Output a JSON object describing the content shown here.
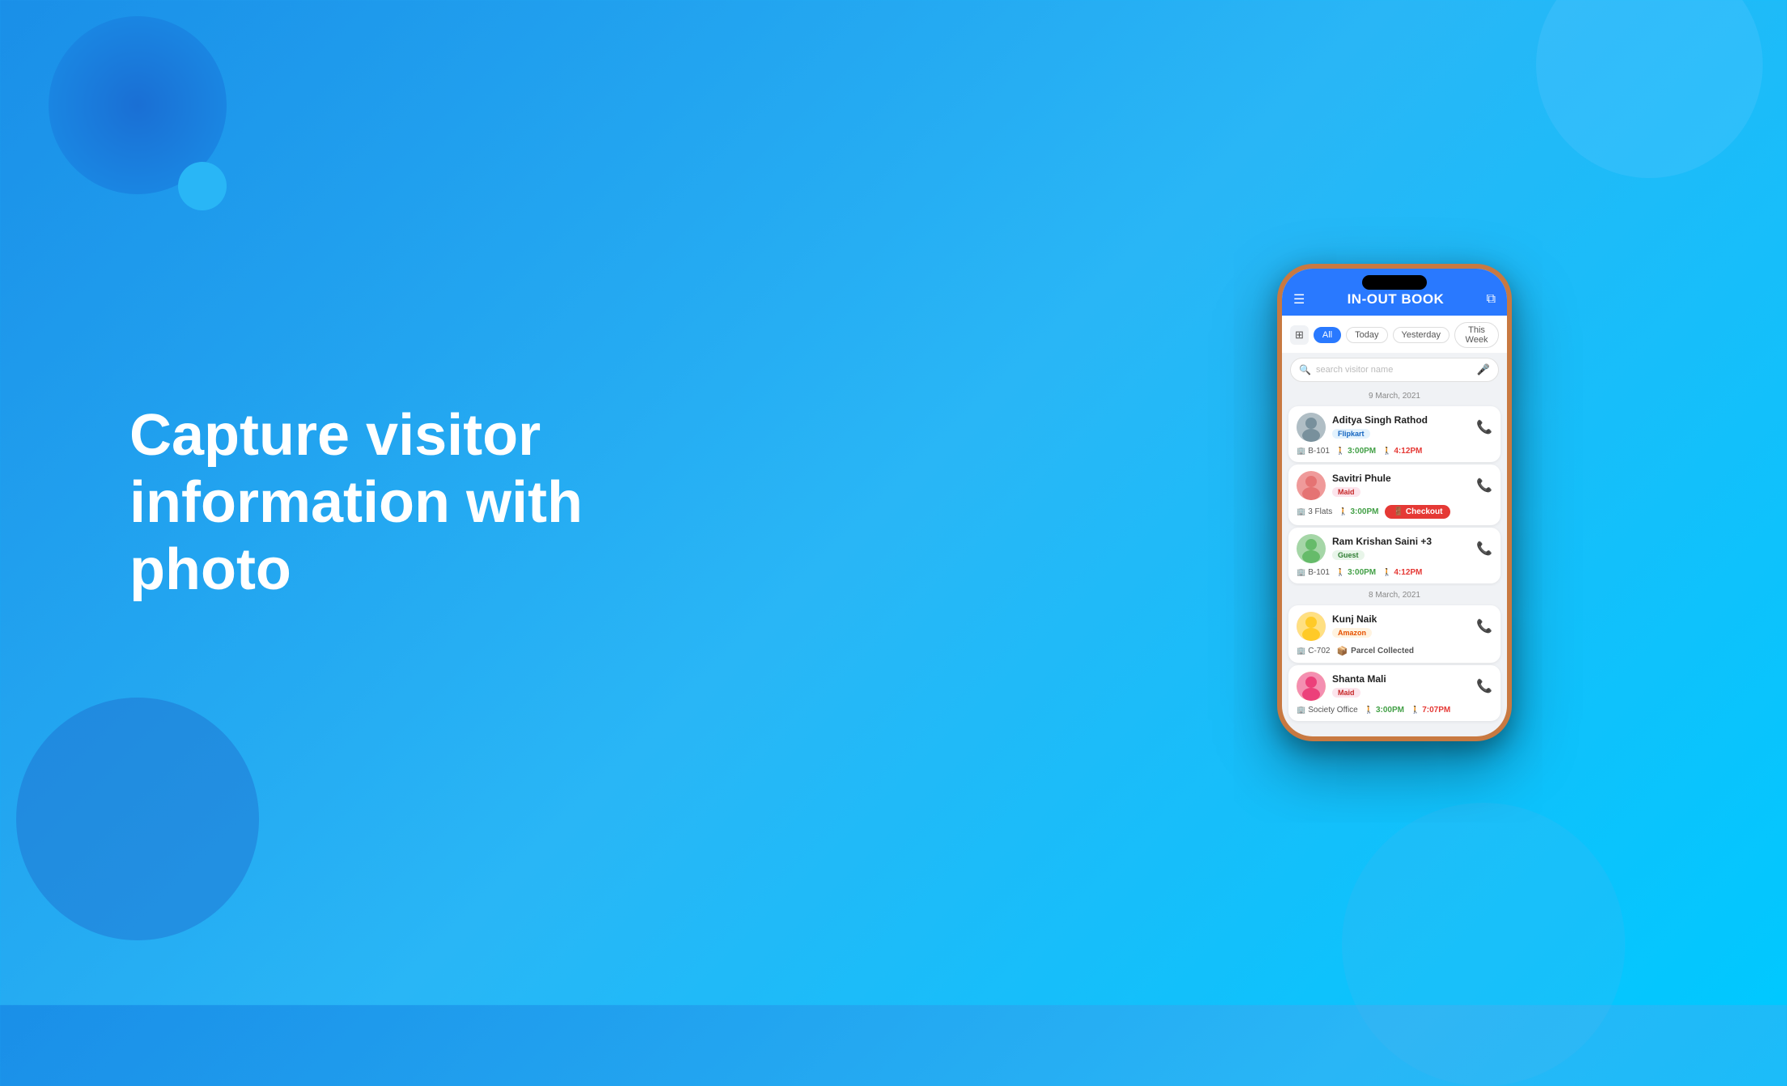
{
  "background": {
    "gradient_start": "#1a8fe8",
    "gradient_end": "#29c5f6"
  },
  "left_content": {
    "heading_line1": "Capture visitor",
    "heading_line2": "information with photo"
  },
  "app": {
    "title": "IN-OUT BOOK",
    "header": {
      "menu_icon": "☰",
      "expand_icon": "⛶"
    },
    "filters": {
      "grid_btn": "⊞",
      "tabs": [
        "All",
        "Today",
        "Yesterday",
        "This Week"
      ],
      "active_tab": "All"
    },
    "search": {
      "placeholder": "search visitor name",
      "mic_icon": "🎤"
    },
    "date_groups": [
      {
        "date": "9 March, 2021",
        "visitors": [
          {
            "id": 1,
            "name": "Aditya Singh Rathod",
            "badge": "Flipkart",
            "badge_type": "flipkart",
            "flat": "B-101",
            "time_in": "3:00PM",
            "time_out": "4:12PM",
            "has_checkout_btn": false,
            "has_parcel": false,
            "avatar_color": "#b0bec5"
          },
          {
            "id": 2,
            "name": "Savitri Phule",
            "badge": "Maid",
            "badge_type": "maid",
            "flat": "3 Flats",
            "time_in": "3:00PM",
            "time_out": null,
            "has_checkout_btn": true,
            "has_parcel": false,
            "avatar_color": "#ef9a9a"
          },
          {
            "id": 3,
            "name": "Ram Krishan Saini +3",
            "badge": "Guest",
            "badge_type": "guest",
            "flat": "B-101",
            "time_in": "3:00PM",
            "time_out": "4:12PM",
            "has_checkout_btn": false,
            "has_parcel": false,
            "avatar_color": "#a5d6a7"
          }
        ]
      },
      {
        "date": "8 March, 2021",
        "visitors": [
          {
            "id": 4,
            "name": "Kunj Naik",
            "badge": "Amazon",
            "badge_type": "amazon",
            "flat": "C-702",
            "time_in": null,
            "time_out": null,
            "has_checkout_btn": false,
            "has_parcel": true,
            "parcel_label": "Parcel Collected",
            "avatar_color": "#ffe082"
          },
          {
            "id": 5,
            "name": "Shanta Mali",
            "badge": "Maid",
            "badge_type": "maid",
            "flat": "Society Office",
            "time_in": "3:00PM",
            "time_out": "7:07PM",
            "has_checkout_btn": false,
            "has_parcel": false,
            "avatar_color": "#f48fb1"
          }
        ]
      }
    ],
    "checkout_btn_label": "Checkout",
    "call_icon": "📞"
  }
}
